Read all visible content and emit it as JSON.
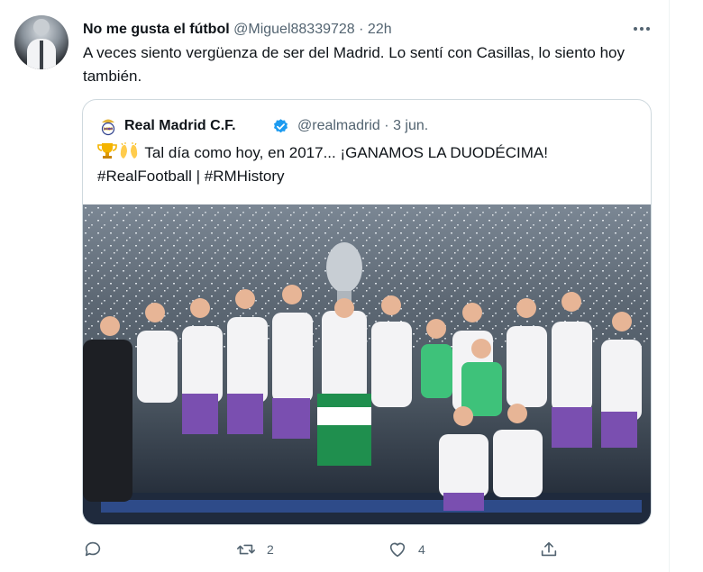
{
  "tweet": {
    "author_name": "No me gusta el fútbol",
    "handle": "@Miguel88339728",
    "separator": "·",
    "time": "22h",
    "text": "A veces siento vergüenza de ser del Madrid. Lo sentí con Casillas, lo siento hoy también."
  },
  "quoted": {
    "author_name": "Real Madrid C.F.",
    "handle": "@realmadrid",
    "separator": "·",
    "date": "3 jun.",
    "text_line1": "Tal día como hoy, en 2017... ¡GANAMOS LA DUODÉCIMA!",
    "text_line2": "#RealFootball | #RMHistory",
    "emojis": [
      "trophy-emoji",
      "raising-hands-emoji"
    ],
    "verified": true
  },
  "actions": {
    "reply_count": "",
    "retweet_count": "2",
    "like_count": "4",
    "share_count": ""
  },
  "colors": {
    "text": "#0f1419",
    "muted": "#536471",
    "border": "#cfd9de",
    "verified": "#1d9bf0"
  },
  "icons": [
    "more-icon",
    "reply-icon",
    "retweet-icon",
    "like-icon",
    "share-icon",
    "verified-badge-icon",
    "real-madrid-crest-icon"
  ]
}
